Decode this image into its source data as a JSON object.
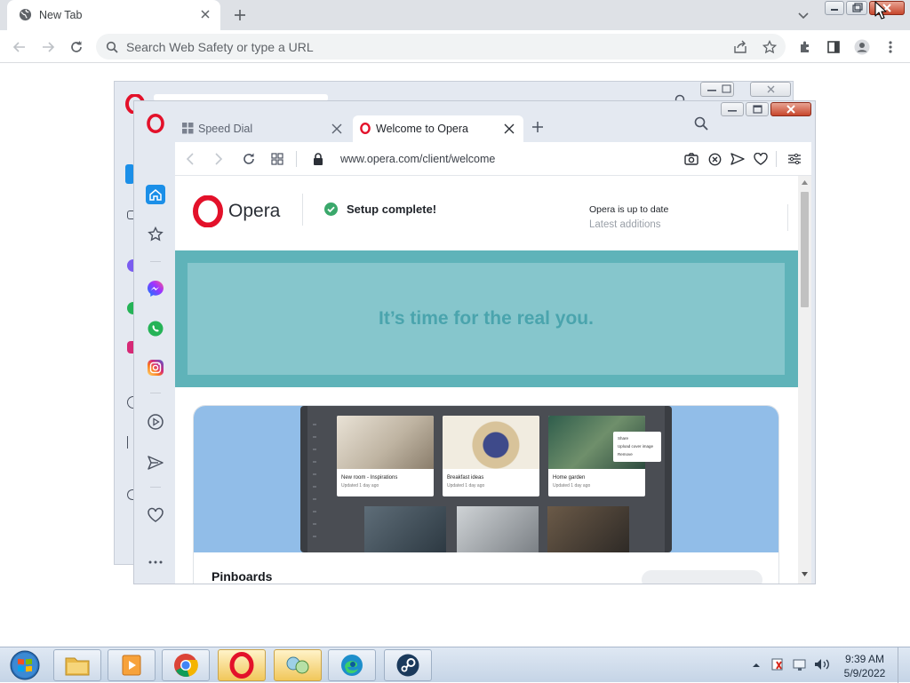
{
  "chrome": {
    "tab_title": "New Tab",
    "omnibox_placeholder": "Search Web Safety or type a URL"
  },
  "opera": {
    "tabs": [
      {
        "label": "Speed Dial"
      },
      {
        "label": "Welcome to Opera"
      }
    ],
    "url": "www.opera.com/client/welcome",
    "brand": "Opera",
    "setup_status": "Setup complete!",
    "update_status": "Opera is up to date",
    "latest_link": "Latest additions",
    "hero_text": "It’s time for the real you.",
    "pins": [
      {
        "title": "New room - Inspirations",
        "sub": "Updated 1 day ago"
      },
      {
        "title": "Breakfast ideas",
        "sub": "Updated 1 day ago"
      },
      {
        "title": "Home garden",
        "sub": "Updated 1 day ago"
      }
    ],
    "pin_menu": [
      "Share",
      "Upload cover image",
      "Remove"
    ],
    "section_title": "Pinboards"
  },
  "taskbar": {
    "time": "9:39 AM",
    "date": "5/9/2022",
    "apps": [
      "file-explorer",
      "media-player",
      "chrome",
      "opera",
      "app-5",
      "edge",
      "steam"
    ]
  },
  "colors": {
    "opera_red": "#e3112a",
    "hero_teal": "#5fb3b9",
    "hero_text": "#4aa4ad",
    "opera_accent_blue": "#1b8fe8"
  }
}
